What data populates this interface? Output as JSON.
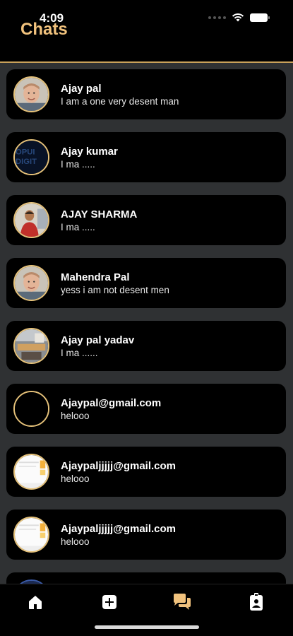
{
  "status_bar": {
    "time": "4:09"
  },
  "header": {
    "title": "Chats"
  },
  "chats": [
    {
      "name": "Ajay pal",
      "message": "I am a one very desent man",
      "avatar": "face-photo"
    },
    {
      "name": "Ajay kumar",
      "message": "I ma .....",
      "avatar": "logo-text"
    },
    {
      "name": "AJAY SHARMA",
      "message": "I ma .....",
      "avatar": "person-red-shirt"
    },
    {
      "name": "Mahendra Pal",
      "message": "yess i am not desent men",
      "avatar": "face-photo"
    },
    {
      "name": "Ajay pal yadav",
      "message": "I ma ......",
      "avatar": "room-photo"
    },
    {
      "name": "Ajaypal@gmail.com",
      "message": "helooo",
      "avatar": "blank"
    },
    {
      "name": "Ajaypaljjjjj@gmail.com",
      "message": "helooo",
      "avatar": "document"
    },
    {
      "name": "Ajaypaljjjjj@gmail.com",
      "message": "helooo",
      "avatar": "document"
    }
  ],
  "tabs": [
    {
      "name": "home",
      "icon": "home-icon"
    },
    {
      "name": "add",
      "icon": "add-icon"
    },
    {
      "name": "chats",
      "icon": "chat-bubbles-icon",
      "active": true
    },
    {
      "name": "profile",
      "icon": "profile-badge-icon"
    }
  ],
  "colors": {
    "accent": "#f1c27d",
    "background": "#2f3133",
    "card": "#000000"
  }
}
